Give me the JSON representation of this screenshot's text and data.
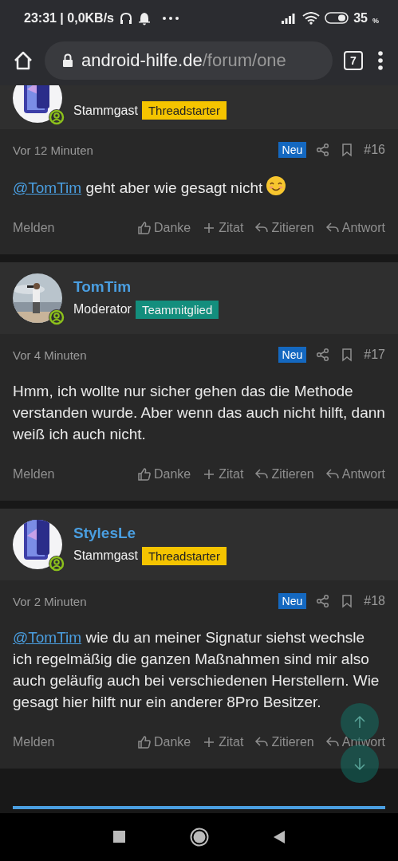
{
  "status_bar": {
    "time": "23:31 | 0,0KB/s",
    "battery": "35",
    "battery_unit": "%"
  },
  "browser": {
    "domain": "android-hilfe.de",
    "path": "/forum/one",
    "tab_count": "7"
  },
  "posts": [
    {
      "user": {
        "role": "Stammgast",
        "badge": "Threadstarter",
        "color": "#f5c400"
      },
      "time": "Vor 12 Minuten",
      "new_label": "Neu",
      "number": "#16",
      "body": {
        "mention": "@TomTim",
        "text": "geht aber wie gesagt nicht",
        "emoji": true
      },
      "actions": {
        "report": "Melden",
        "thanks": "Danke",
        "quote": "Zitat",
        "cite": "Zitieren",
        "reply": "Antwort"
      }
    },
    {
      "user": {
        "name": "TomTim",
        "role": "Moderator",
        "badge": "Teammitglied",
        "color": "#138e7d"
      },
      "time": "Vor 4 Minuten",
      "new_label": "Neu",
      "number": "#17",
      "body": {
        "text": "Hmm, ich wollte nur sicher gehen das die Methode verstanden wurde. Aber wenn das auch nicht hilft, dann weiß ich auch nicht.",
        "emoji": false
      },
      "actions": {
        "report": "Melden",
        "thanks": "Danke",
        "quote": "Zitat",
        "cite": "Zitieren",
        "reply": "Antwort"
      }
    },
    {
      "user": {
        "name": "StylesLe",
        "role": "Stammgast",
        "badge": "Threadstarter",
        "color": "#f5c400"
      },
      "time": "Vor 2 Minuten",
      "new_label": "Neu",
      "number": "#18",
      "body": {
        "mention": "@TomTim",
        "text": "wie du an meiner Signatur siehst wechsle ich regelmäßig die ganzen Maßnahmen sind mir also auch geläufig auch bei verschiedenen Herstellern. Wie gesagt hier hilft nur ein anderer 8Pro Besitzer.",
        "emoji": false
      },
      "actions": {
        "report": "Melden",
        "thanks": "Danke",
        "quote": "Zitat",
        "cite": "Zitieren",
        "reply": "Antwort"
      }
    }
  ]
}
